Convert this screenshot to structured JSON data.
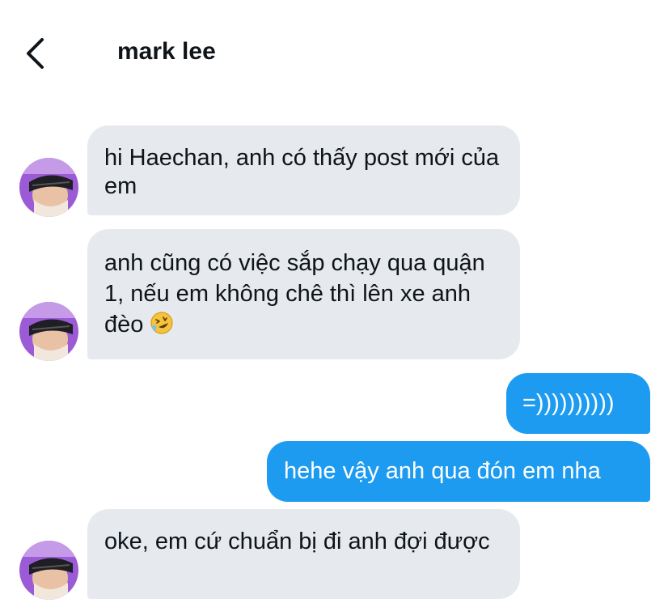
{
  "header": {
    "title": "mark lee",
    "back_icon": "chevron-left-icon"
  },
  "messages": [
    {
      "sender": "them",
      "text": "hi Haechan, anh có thấy post mới của em"
    },
    {
      "sender": "them",
      "text": "anh cũng có việc sắp chạy qua quận 1, nếu em không chê thì lên xe anh đèo",
      "emoji": "rolling-on-floor-laughing-icon"
    },
    {
      "sender": "me",
      "text": "=))))))))))"
    },
    {
      "sender": "me",
      "text": "hehe vậy anh qua đón em nha"
    },
    {
      "sender": "them",
      "text": "oke, em cứ chuẩn bị đi anh đợi được"
    }
  ],
  "colors": {
    "incoming_bubble": "#e6e9ed",
    "outgoing_bubble": "#1d9bf0",
    "text_dark": "#0f1419",
    "text_light": "#ffffff"
  }
}
